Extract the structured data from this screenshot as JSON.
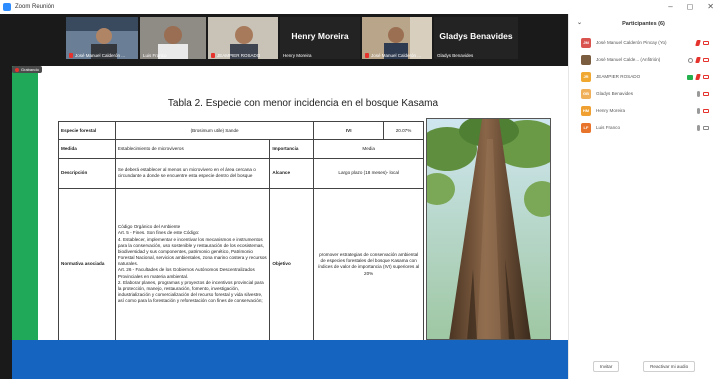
{
  "window": {
    "title": "Zoom Reunión"
  },
  "window_controls": {
    "minimize": "–",
    "maximize": "◻",
    "close": "✕"
  },
  "video_strip": [
    {
      "name": "José Manuel Calderón ...",
      "muted": true
    },
    {
      "name": "Luis Franco",
      "muted": false
    },
    {
      "name": "JEAMPIER ROSADO",
      "muted": true
    },
    {
      "name": "Henry Moreira",
      "big_name": "Henry Moreira",
      "muted": false
    },
    {
      "name": "José Manuel Calderón ...",
      "muted": true
    },
    {
      "name": "Gladys Benavides",
      "big_name": "Gladys Benavides",
      "muted": false
    }
  ],
  "recording_label": "Grabando",
  "slide": {
    "title": "Tabla 2. Especie con menor incidencia en el bosque Kasama",
    "table": {
      "especie_label": "Especie forestal",
      "especie_value": "(Brosimum utile) Sande",
      "ivi_label": "IVI",
      "ivi_value": "20.07%",
      "medida_label": "Medida",
      "medida_value": "Establecimiento de microviveros",
      "importancia_label": "Importancia",
      "importancia_value": "Media",
      "descripcion_label": "Descripción",
      "descripcion_value": "Se deberá establecer al menos un microvivero en el área cercana o circundante a donde se encuentre esta especie dentro del bosque",
      "alcance_label": "Alcance",
      "alcance_value": "Largo plazo (18 meses)- local",
      "normativa_label": "Normativa asociada",
      "normativa_lines": [
        "Código Orgánico del Ambiente",
        "Art. 5 - Fines. Son fines de este Código:",
        "4. Establecer, implementar e incentivar los mecanismos e instrumentos para la conservación, uso sostenible y restauración de los ecosistemas, biodiversidad y sus componentes, patrimonio genético, Patrimonio Forestal Nacional, servicios ambientales, zona marino costera y recursos naturales.",
        "Art. 26 - Facultades de los Gobiernos Autónomos Descentralizados Provinciales en materia ambiental.",
        "2. Elaborar planes, programas y proyectos de incentivos provincial para la protección, manejo, restauración, fomento, investigación, industrialización y comercialización del recurso forestal y vida silvestre, así como para la forestación y reforestación con fines de conservación;"
      ],
      "objetivo_label": "Objetivo",
      "objetivo_value": "promover estrategias de conservación ambiental de especies forestales del bosque Kasama con índices de valor de importancia (IVI) superiores al 20%"
    }
  },
  "participants": {
    "title": "Participantes (6)",
    "list": [
      {
        "initials": "JM",
        "color": "#d9534f",
        "name": "José Manuel Calderón Pincay (Yo)",
        "icons": [
          "mic-red",
          "cam-red"
        ]
      },
      {
        "initials": "",
        "color": "#7a5c3e",
        "name": "José Manuel Calde... (Anfitrión)",
        "icons": [
          "info",
          "mic-red",
          "cam-red"
        ]
      },
      {
        "initials": "JR",
        "color": "#f0a830",
        "name": "JEAMPIER ROSADO",
        "icons": [
          "share",
          "mic-red",
          "cam-red"
        ]
      },
      {
        "initials": "GB",
        "color": "#f0b05a",
        "name": "Gladys Benavides",
        "icons": [
          "mic-grey",
          "cam-red"
        ]
      },
      {
        "initials": "HM",
        "color": "#f0a030",
        "name": "Henry Moreira",
        "icons": [
          "mic-grey",
          "cam-red"
        ]
      },
      {
        "initials": "LF",
        "color": "#e8732a",
        "name": "Luis Franco",
        "icons": [
          "mic-grey",
          "cam-grey"
        ]
      }
    ],
    "invite_label": "Invitar",
    "unmute_label": "Reactivar mi audio"
  }
}
